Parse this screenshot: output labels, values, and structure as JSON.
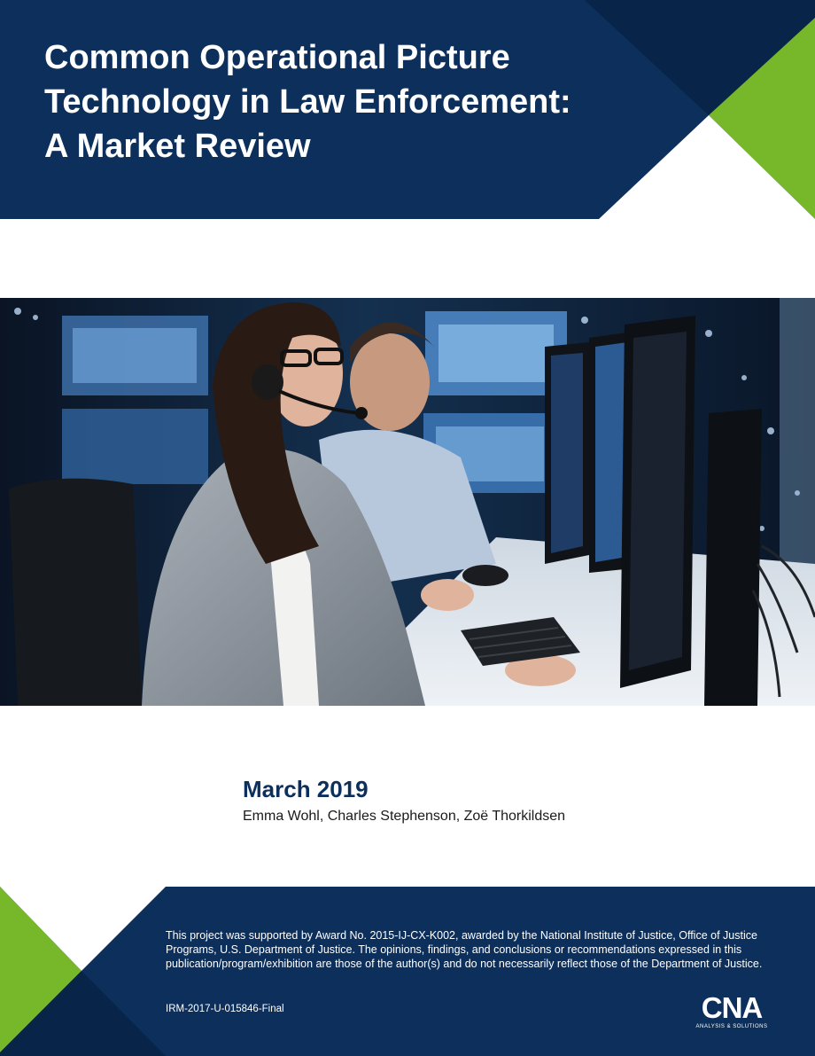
{
  "header": {
    "title_lines": [
      "Common Operational Picture",
      "Technology in Law Enforcement:",
      "A Market Review"
    ]
  },
  "cover_image": {
    "description_icon": "dispatch-center-photo-icon"
  },
  "meta": {
    "date": "March 2019",
    "authors": "Emma Wohl, Charles Stephenson, Zoë Thorkildsen"
  },
  "footer": {
    "disclaimer": "This project was supported by Award No. 2015-IJ-CX-K002, awarded by the National Institute of Justice, Office of Justice Programs, U.S. Department of Justice. The opinions, findings, and conclusions or recommendations expressed in this publication/program/exhibition are those of the author(s) and do not necessarily reflect those of the Department of Justice.",
    "report_id": "IRM-2017-U-015846-Final"
  },
  "logo": {
    "text": "CNA",
    "tagline": "ANALYSIS & SOLUTIONS"
  },
  "colors": {
    "navy": "#0c2f5c",
    "dark_navy": "#082448",
    "green": "#77b82a"
  }
}
